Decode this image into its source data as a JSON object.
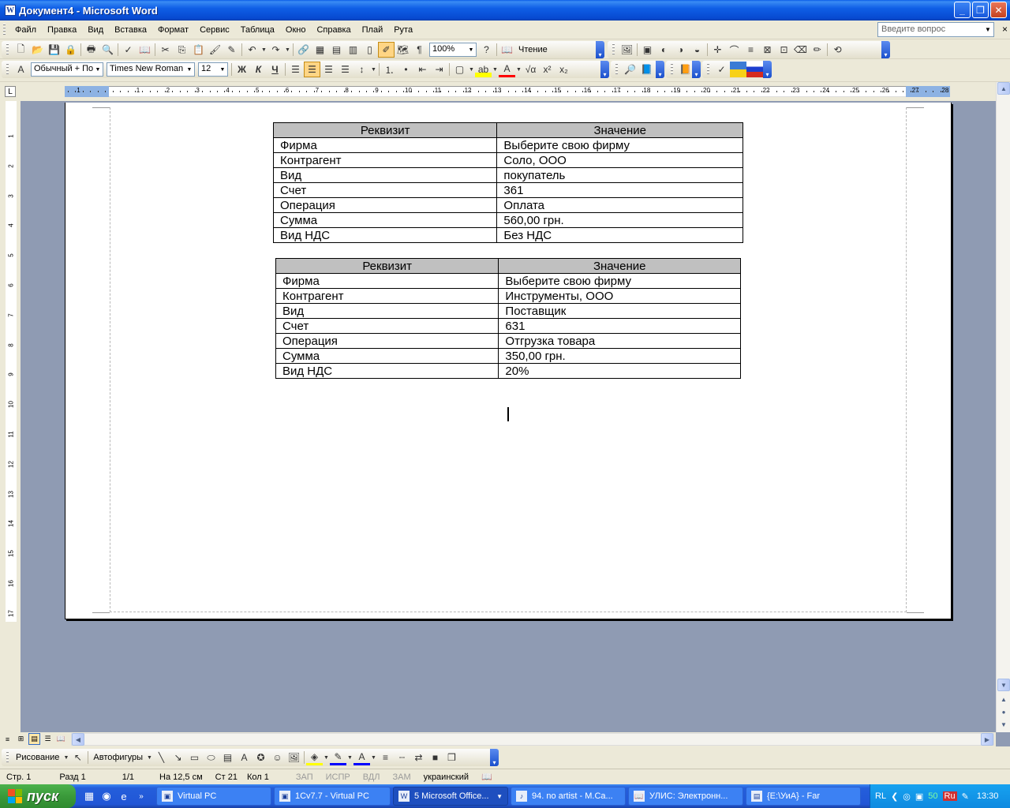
{
  "window": {
    "title": "Документ4 - Microsoft Word",
    "app_icon": "word-icon"
  },
  "menu": {
    "items": [
      "Файл",
      "Правка",
      "Вид",
      "Вставка",
      "Формат",
      "Сервис",
      "Таблица",
      "Окно",
      "Справка",
      "Плай",
      "Рута"
    ],
    "help_placeholder": "Введите вопрос",
    "close_glyph": "×"
  },
  "standard_toolbar": {
    "zoom": "100%",
    "reading_label": "Чтение"
  },
  "format_toolbar": {
    "style": "Обычный + По",
    "font": "Times New Roman",
    "size": "12"
  },
  "ruler": {
    "h_numbers": [
      "1",
      "1",
      "2",
      "3",
      "4",
      "5",
      "6",
      "7",
      "8",
      "9",
      "10",
      "11",
      "12",
      "13",
      "14",
      "15",
      "16",
      "17",
      "18",
      "19",
      "20",
      "21",
      "22",
      "23",
      "24",
      "25",
      "26",
      "27",
      "28"
    ],
    "v_numbers": [
      "1",
      "2",
      "3",
      "4",
      "5",
      "6",
      "7",
      "8",
      "9",
      "10",
      "11",
      "12",
      "13",
      "14",
      "15",
      "16",
      "17"
    ]
  },
  "tables": [
    {
      "header": [
        "Реквизит",
        "Значение"
      ],
      "rows": [
        [
          "Фирма",
          "Выберите свою фирму"
        ],
        [
          "Контрагент",
          "Соло, ООО"
        ],
        [
          "Вид",
          "покупатель"
        ],
        [
          "Счет",
          "361"
        ],
        [
          "Операция",
          "Оплата"
        ],
        [
          "Сумма",
          "560,00 грн."
        ],
        [
          "Вид НДС",
          "Без НДС"
        ]
      ]
    },
    {
      "header": [
        "Реквизит",
        "Значение"
      ],
      "rows": [
        [
          "Фирма",
          "Выберите свою фирму"
        ],
        [
          "Контрагент",
          "Инструменты, ООО"
        ],
        [
          "Вид",
          "Поставщик"
        ],
        [
          "Счет",
          "631"
        ],
        [
          "Операция",
          "Отгрузка товара"
        ],
        [
          "Сумма",
          "350,00 грн."
        ],
        [
          "Вид НДС",
          "20%"
        ]
      ]
    }
  ],
  "drawing_toolbar": {
    "draw_label": "Рисование",
    "autoshapes_label": "Автофигуры"
  },
  "status": {
    "page": "Стр. 1",
    "section": "Разд 1",
    "pages": "1/1",
    "at": "На 12,5 см",
    "line": "Ст 21",
    "col": "Кол 1",
    "rec": "ЗАП",
    "trk": "ИСПР",
    "ext": "ВДЛ",
    "ovr": "ЗАМ",
    "language": "украинский"
  },
  "taskbar": {
    "start_label": "пуск",
    "tasks": [
      {
        "label": "Virtual PC",
        "icon": "virtualpc-icon"
      },
      {
        "label": "1Cv7.7 - Virtual PC",
        "icon": "virtualpc-icon"
      },
      {
        "label": "5 Microsoft Office...",
        "icon": "word-icon"
      },
      {
        "label": "94. no artist - M.Ca...",
        "icon": "winamp-icon"
      },
      {
        "label": "УЛИС: Электронн...",
        "icon": "book-icon"
      },
      {
        "label": "{E:\\УиА} - Far",
        "icon": "far-icon"
      }
    ],
    "tray": {
      "lang": "RL",
      "num": "50",
      "input": "Ru",
      "time": "13:30"
    }
  },
  "colors": {
    "title_bar": "#0a5ce8",
    "table_header": "#c0c0c0",
    "workspace": "#8f9bb3",
    "start_green": "#3a9a3a"
  }
}
